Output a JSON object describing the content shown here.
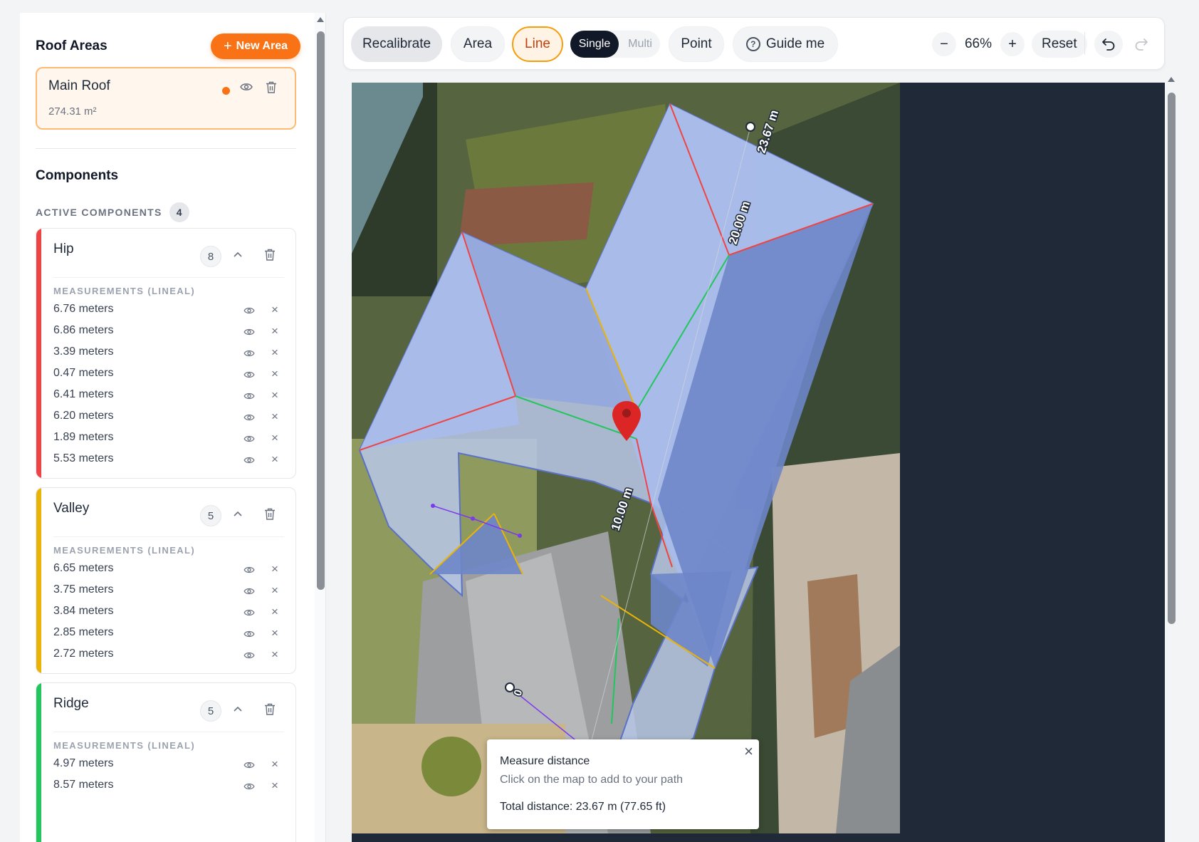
{
  "sidebar": {
    "title": "Roof Areas",
    "new_area_label": "New Area",
    "area": {
      "name": "Main Roof",
      "size": "274.31 m²"
    },
    "components_title": "Components",
    "active_label": "ACTIVE COMPONENTS",
    "active_count": "4",
    "measurements_label": "MEASUREMENTS (LINEAL)",
    "components": [
      {
        "name": "Hip",
        "count": "8",
        "color": "#ef4444",
        "measurements": [
          "6.76 meters",
          "6.86 meters",
          "3.39 meters",
          "0.47 meters",
          "6.41 meters",
          "6.20 meters",
          "1.89 meters",
          "5.53 meters"
        ]
      },
      {
        "name": "Valley",
        "count": "5",
        "color": "#eab308",
        "measurements": [
          "6.65 meters",
          "3.75 meters",
          "3.84 meters",
          "2.85 meters",
          "2.72 meters"
        ]
      },
      {
        "name": "Ridge",
        "count": "5",
        "color": "#22c55e",
        "measurements": [
          "4.97 meters",
          "8.57 meters"
        ]
      }
    ]
  },
  "toolbar": {
    "recalibrate": "Recalibrate",
    "area": "Area",
    "line": "Line",
    "single": "Single",
    "multi": "Multi",
    "point": "Point",
    "guide": "Guide me",
    "zoom_out": "−",
    "zoom": "66%",
    "zoom_in": "+",
    "reset": "Reset"
  },
  "map": {
    "labels": {
      "a": "23.67 m",
      "b": "20.00 m",
      "c": "10.00 m",
      "d": "0"
    }
  },
  "popup": {
    "title": "Measure distance",
    "subtitle": "Click on the map to add to your path",
    "total": "Total distance: 23.67 m (77.65 ft)",
    "close": "×"
  },
  "colors": {
    "accent": "#f97316",
    "hip": "#ef4444",
    "valley": "#eab308",
    "ridge": "#22c55e"
  }
}
